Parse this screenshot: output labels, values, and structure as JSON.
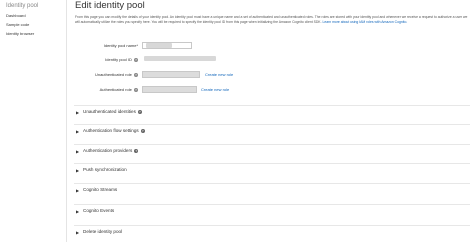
{
  "sidebar": {
    "title": "Identity pool",
    "items": [
      {
        "label": "Dashboard"
      },
      {
        "label": "Sample code"
      },
      {
        "label": "Identity browser"
      }
    ]
  },
  "main": {
    "title": "Edit identity pool",
    "description": "From this page you can modify the details of your identity pool. An identity pool must have a unique name and a set of authenticated and unauthenticated roles. The roles are stored with your identity pool and whenever we receive a request to authorize a user we will automatically utilize the roles you specify here. You will be required to specify the identity pool ID from this page when initializing the Amazon Cognito client SDK.",
    "description_link": "Learn more about using IAM roles with Amazon Cognito.",
    "form": {
      "pool_name_label": "Identity pool name*",
      "pool_id_label": "Identity pool ID",
      "unauth_role_label": "Unauthenticated role",
      "auth_role_label": "Authenticated role",
      "create_new_role": "Create new role",
      "info_glyph": "?"
    },
    "sections": [
      {
        "label": "Unauthenticated identities",
        "info": true
      },
      {
        "label": "Authentication flow settings",
        "info": true
      },
      {
        "label": "Authentication providers",
        "info": true
      },
      {
        "label": "Push synchronization",
        "info": false
      },
      {
        "label": "Cognito Streams",
        "info": false
      },
      {
        "label": "Cognito Events",
        "info": false
      },
      {
        "label": "Delete identity pool",
        "info": false
      }
    ],
    "expand_icon": "▶"
  },
  "colors": {
    "link": "#1166bb",
    "text": "#333333",
    "field": "#dcdcdc"
  }
}
